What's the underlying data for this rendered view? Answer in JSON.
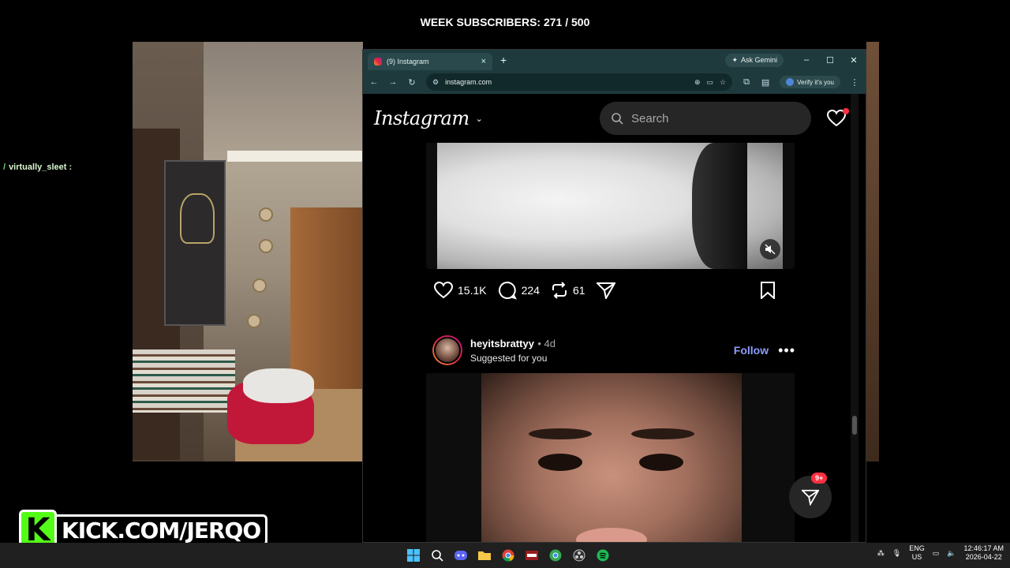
{
  "overlay": {
    "subscriber_goal": "WEEK SUBSCRIBERS: 271 / 500",
    "chat_username": "virtually_sleet :",
    "kick_logo_letter": "K",
    "kick_logo_text": "KICK.COM/JERQO"
  },
  "browser": {
    "tab_title": "(9) Instagram",
    "tab_close": "×",
    "new_tab": "+",
    "ask_gemini": "Ask Gemini",
    "window_controls": [
      "–",
      "☐",
      "✕"
    ],
    "url": "instagram.com",
    "verify": "Verify it's you"
  },
  "instagram": {
    "logo": "Instagram",
    "search_placeholder": "Search",
    "post1": {
      "likes": "15.1K",
      "comments": "224",
      "reposts": "61"
    },
    "post2": {
      "username": "heyitsbrattyy",
      "age": "• 4d",
      "subtitle": "Suggested for you",
      "follow": "Follow",
      "more": "•••"
    },
    "messages_badge": "9+"
  },
  "taskbar": {
    "lang_line1": "ENG",
    "lang_line2": "US",
    "time": "12:46:17 AM",
    "date": "2026-04-22"
  },
  "colors": {
    "instagram_blue": "#8c9dff",
    "notification_red": "#ff3040",
    "kick_green": "#53fc18",
    "chrome_frame": "#1e3a3d"
  }
}
